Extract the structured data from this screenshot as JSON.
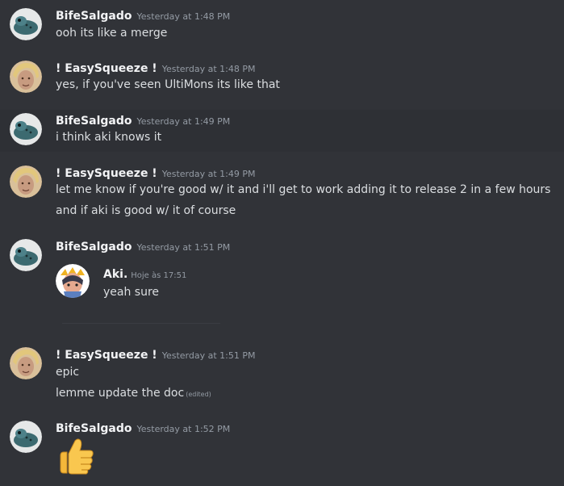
{
  "messages": [
    {
      "author": "BifeSalgado",
      "timestamp": "Yesterday at 1:48 PM",
      "lines": [
        "ooh its like a merge"
      ]
    },
    {
      "author": "! EasySqueeze !",
      "timestamp": "Yesterday at 1:48 PM",
      "lines": [
        "yes, if you've seen UltiMons its like that"
      ]
    },
    {
      "author": "BifeSalgado",
      "timestamp": "Yesterday at 1:49 PM",
      "lines": [
        "i think aki knows it"
      ]
    },
    {
      "author": "! EasySqueeze !",
      "timestamp": "Yesterday at 1:49 PM",
      "lines": [
        "let me know if you're good w/ it and i'll get to work adding it to release 2 in a few hours",
        "and if aki is good w/ it of course"
      ]
    },
    {
      "author": "BifeSalgado",
      "timestamp": "Yesterday at 1:51 PM",
      "embed": {
        "author": "Aki.",
        "timestamp": "Hoje às 17:51",
        "text": "yeah sure"
      }
    },
    {
      "author": "! EasySqueeze !",
      "timestamp": "Yesterday at 1:51 PM",
      "lines": [
        "epic",
        "lemme update the doc"
      ],
      "edited_label": "(edited)"
    },
    {
      "author": "BifeSalgado",
      "timestamp": "Yesterday at 1:52 PM",
      "emoji": "thumbs-up"
    }
  ],
  "colors": {
    "background": "#313338",
    "username": "#f2f3f5",
    "text": "#dbdee1",
    "timestamp": "#949ba4"
  }
}
